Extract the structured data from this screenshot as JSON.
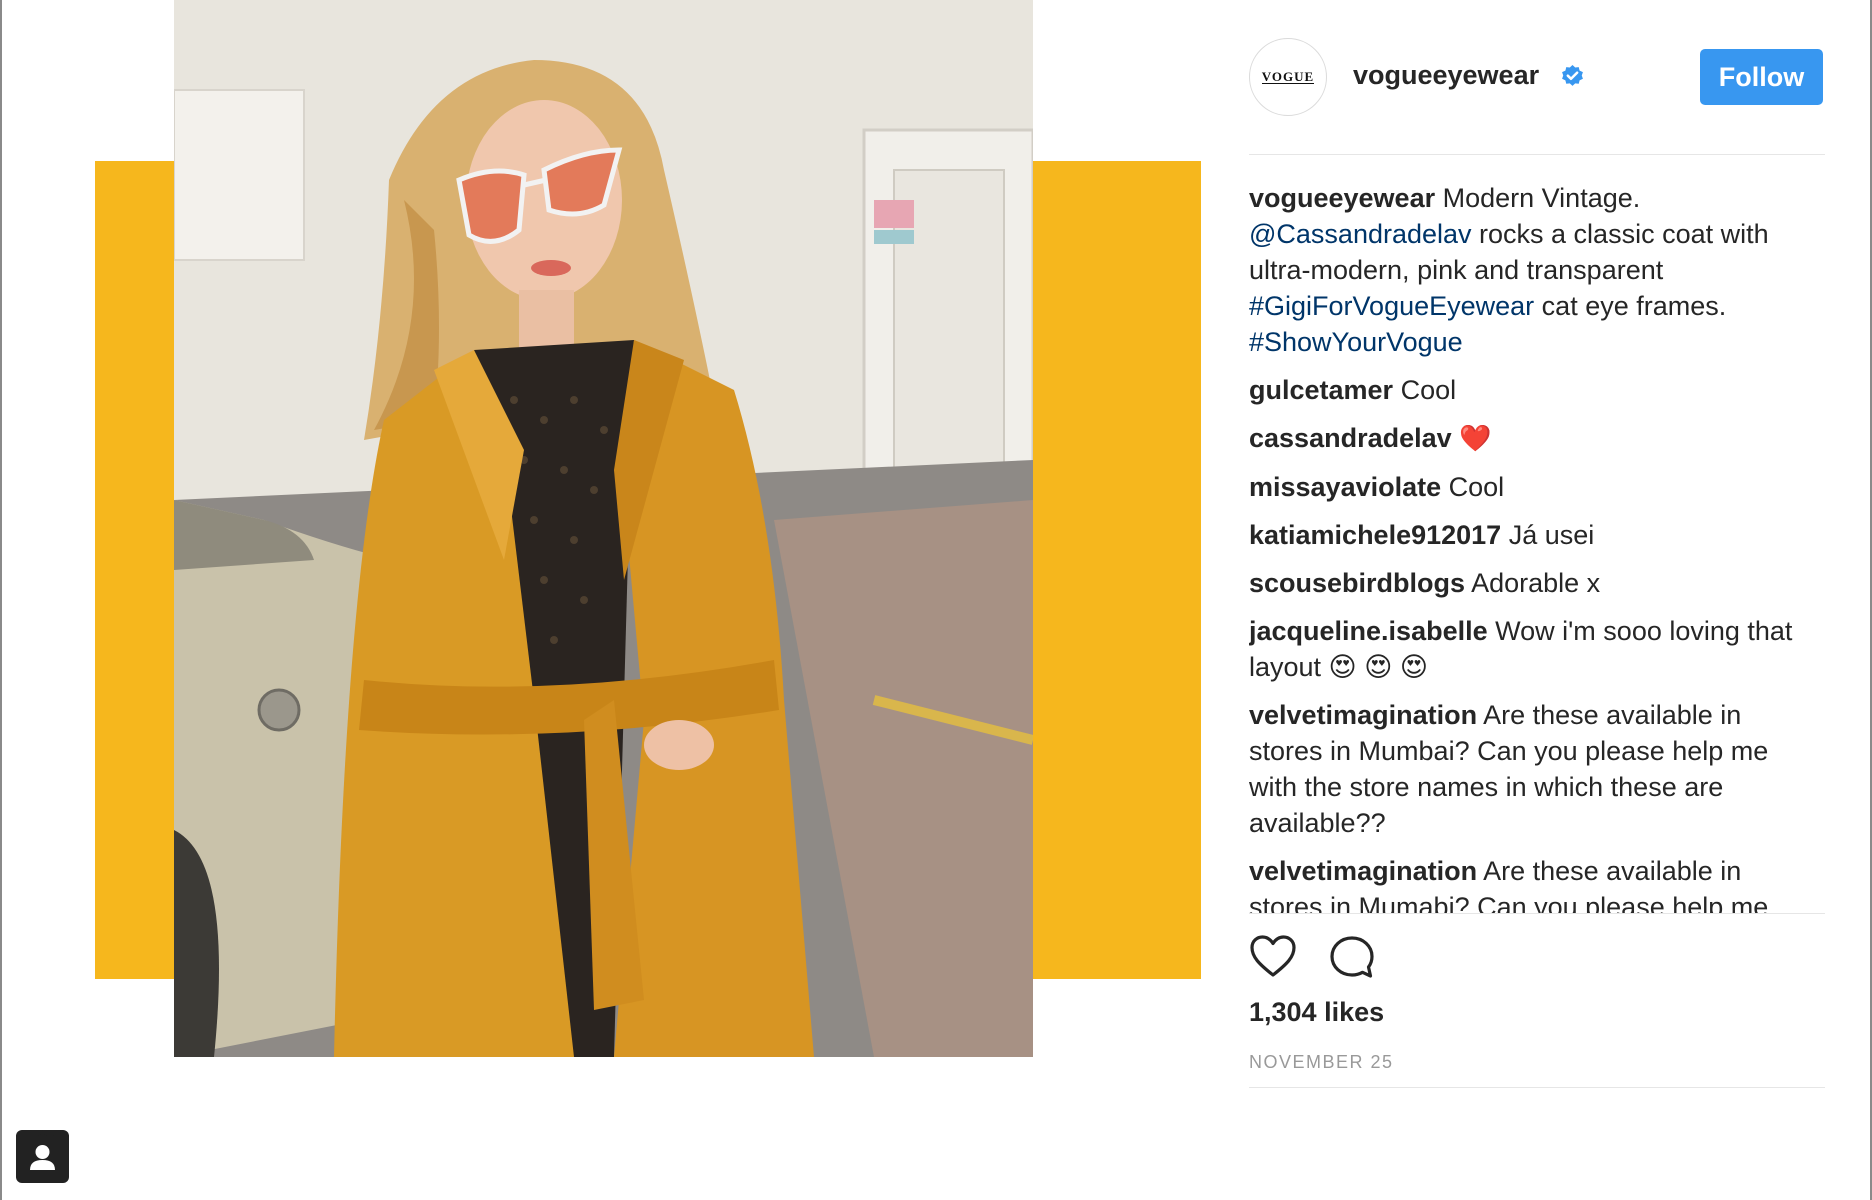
{
  "post": {
    "username": "vogueeyewear",
    "avatar_text": "VOGUE",
    "follow_label": "Follow",
    "caption": {
      "username": "vogueeyewear",
      "text_1": " Modern Vintage. ",
      "mention": "@Cassandradelav",
      "text_2": " rocks a classic coat with ultra-modern, pink and transparent ",
      "hashtag_1": "#GigiForVogueEyewear",
      "text_3": " cat eye frames. ",
      "hashtag_2": "#ShowYourVogue"
    },
    "comments": [
      {
        "username": "gulcetamer",
        "text": "Cool"
      },
      {
        "username": "cassandradelav",
        "text": "❤️"
      },
      {
        "username": "missayaviolate",
        "text": "Cool"
      },
      {
        "username": "katiamichele912017",
        "text": "Já usei"
      },
      {
        "username": "scousebirdblogs",
        "text": "Adorable x"
      },
      {
        "username": "jacqueline.isabelle",
        "text": "Wow i'm sooo loving that layout 😍 😍 😍"
      },
      {
        "username": "velvetimagination",
        "text": "Are these available in stores in Mumbai? Can you please help me with the store names in which these are available??"
      },
      {
        "username": "velvetimagination",
        "text": "Are these available in stores in Mumabi? Can you please help me"
      }
    ],
    "likes": "1,304 likes",
    "date": "NOVEMBER 25"
  },
  "colors": {
    "accent_yellow": "#f6b71d",
    "follow_blue": "#3897f0",
    "link_blue": "#003569",
    "verified_blue": "#3897f0"
  },
  "icons": [
    "verified-badge-icon",
    "heart-icon",
    "comment-bubble-icon",
    "user-silhouette-icon"
  ]
}
